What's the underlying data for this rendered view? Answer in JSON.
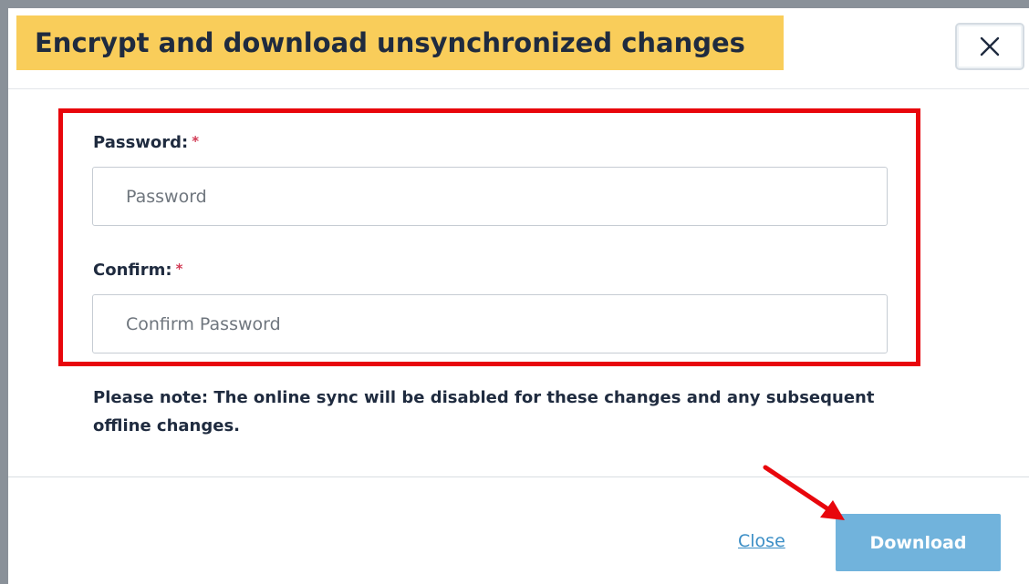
{
  "dialog": {
    "title": "Encrypt and download unsynchronized changes",
    "close_icon": "close-icon"
  },
  "form": {
    "password": {
      "label": "Password:",
      "required_mark": "*",
      "placeholder": "Password",
      "value": ""
    },
    "confirm": {
      "label": "Confirm:",
      "required_mark": "*",
      "placeholder": "Confirm Password",
      "value": ""
    }
  },
  "note": "Please note: The online sync will be disabled for these changes and any subsequent offline changes.",
  "footer": {
    "close_label": "Close",
    "download_label": "Download"
  },
  "colors": {
    "title_highlight": "#f9cd5a",
    "annotation_red": "#e8060c",
    "download_button": "#71b3dc",
    "link_blue": "#3b8ec6",
    "text_dark": "#1f2b3f"
  },
  "annotations": {
    "highlight_box": "red-rectangle",
    "pointer": "red-arrow-icon"
  }
}
